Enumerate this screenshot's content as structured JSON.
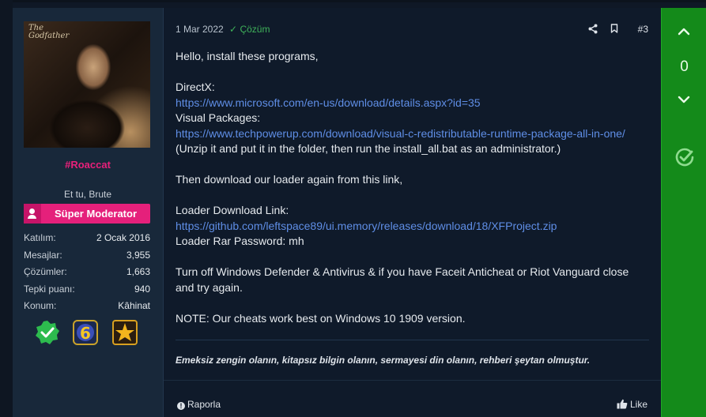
{
  "user": {
    "username": "#Roaccat",
    "title": "Et tu, Brute",
    "role": "Süper Moderator",
    "avatar_logo_text": "The Godfather",
    "stats": [
      {
        "label": "Katılım:",
        "value": "2 Ocak 2016"
      },
      {
        "label": "Mesajlar:",
        "value": "3,955"
      },
      {
        "label": "Çözümler:",
        "value": "1,663"
      },
      {
        "label": "Tepki puanı:",
        "value": "940"
      },
      {
        "label": "Konum:",
        "value": "Kâhinat"
      }
    ],
    "badge_icons": [
      "verified-check-icon",
      "six-medal-icon",
      "star-award-icon"
    ]
  },
  "post": {
    "date": "1 Mar 2022",
    "solution_label": "Çözüm",
    "post_number": "#3",
    "lines": {
      "greeting": "Hello, install these programs,",
      "directx_label": "DirectX:",
      "directx_url": "https://www.microsoft.com/en-us/download/details.aspx?id=35",
      "vc_label": "Visual Packages:",
      "vc_url": "https://www.techpowerup.com/download/visual-c-redistributable-runtime-package-all-in-one/",
      "vc_note": "(Unzip it and put it in the folder, then run the install_all.bat as an administrator.)",
      "loader_intro": "Then download our loader again from this link,",
      "loader_label": "Loader Download Link:",
      "loader_url": "https://github.com/leftspace89/ui.memory/releases/download/18/XFProject.zip",
      "rar_password": "Loader Rar Password: mh",
      "turn_off_1": "Turn off Windows Defender & Antivirus & if you have Faceit Anticheat or Riot Vanguard close",
      "turn_off_2": "and try again.",
      "note": "NOTE: Our cheats work best on Windows 10 1909 version."
    },
    "signature": "Emeksiz zengin olanın, kitapsız bilgin olanın, sermayesi din olanın, rehberi şeytan olmuştur.",
    "report_label": "Raporla",
    "like_label": "Like"
  },
  "vote": {
    "count": "0"
  },
  "colors": {
    "username": "#e8207a",
    "role_banner": "#e5207b",
    "link": "#5f8ee6",
    "solved": "#3fb25a",
    "vote_bar": "#148a1a"
  }
}
